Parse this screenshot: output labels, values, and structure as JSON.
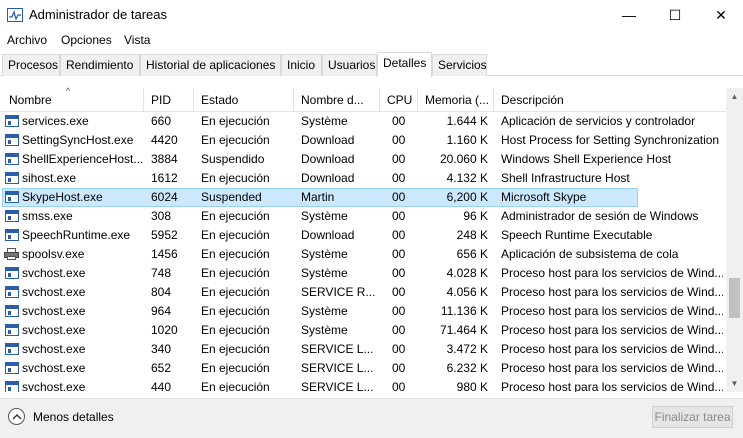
{
  "window": {
    "title": "Administrador de tareas",
    "min_glyph": "—",
    "max_glyph": "☐",
    "close_glyph": "✕"
  },
  "menu": [
    "Archivo",
    "Opciones",
    "Vista"
  ],
  "tabs": [
    "Procesos",
    "Rendimiento",
    "Historial de aplicaciones",
    "Inicio",
    "Usuarios",
    "Detalles",
    "Servicios"
  ],
  "active_tab": "Detalles",
  "columns": [
    "Nombre",
    "PID",
    "Estado",
    "Nombre d...",
    "CPU",
    "Memoria (...",
    "Descripción"
  ],
  "rows": [
    {
      "name": "services.exe",
      "pid": "660",
      "status": "En ejecución",
      "user": "Système",
      "cpu": "00",
      "mem": "1.644 K",
      "desc": "Aplicación de servicios y controlador",
      "icon": "process-icon"
    },
    {
      "name": "SettingSyncHost.exe",
      "pid": "4420",
      "status": "En ejecución",
      "user": "Download",
      "cpu": "00",
      "mem": "1.160 K",
      "desc": "Host Process for Setting Synchronization",
      "icon": "process-icon"
    },
    {
      "name": "ShellExperienceHost....",
      "pid": "3884",
      "status": "Suspendido",
      "user": "Download",
      "cpu": "00",
      "mem": "20.060 K",
      "desc": "Windows Shell Experience Host",
      "icon": "process-icon"
    },
    {
      "name": "sihost.exe",
      "pid": "1612",
      "status": "En ejecución",
      "user": "Download",
      "cpu": "00",
      "mem": "4.132 K",
      "desc": "Shell Infrastructure Host",
      "icon": "process-icon"
    },
    {
      "name": "SkypeHost.exe",
      "pid": "6024",
      "status": "Suspended",
      "user": "Martin",
      "cpu": "00",
      "mem": "6,200 K",
      "desc": "Microsoft Skype",
      "icon": "process-icon",
      "selected": true
    },
    {
      "name": "smss.exe",
      "pid": "308",
      "status": "En ejecución",
      "user": "Système",
      "cpu": "00",
      "mem": "96 K",
      "desc": "Administrador de sesión de Windows",
      "icon": "process-icon"
    },
    {
      "name": "SpeechRuntime.exe",
      "pid": "5952",
      "status": "En ejecución",
      "user": "Download",
      "cpu": "00",
      "mem": "248 K",
      "desc": "Speech Runtime Executable",
      "icon": "process-icon"
    },
    {
      "name": "spoolsv.exe",
      "pid": "1456",
      "status": "En ejecución",
      "user": "Système",
      "cpu": "00",
      "mem": "656 K",
      "desc": "Aplicación de subsistema de cola",
      "icon": "printer-icon"
    },
    {
      "name": "svchost.exe",
      "pid": "748",
      "status": "En ejecución",
      "user": "Système",
      "cpu": "00",
      "mem": "4.028 K",
      "desc": "Proceso host para los servicios de Wind...",
      "icon": "process-icon"
    },
    {
      "name": "svchost.exe",
      "pid": "804",
      "status": "En ejecución",
      "user": "SERVICE R...",
      "cpu": "00",
      "mem": "4.056 K",
      "desc": "Proceso host para los servicios de Wind...",
      "icon": "process-icon"
    },
    {
      "name": "svchost.exe",
      "pid": "964",
      "status": "En ejecución",
      "user": "Système",
      "cpu": "00",
      "mem": "11.136 K",
      "desc": "Proceso host para los servicios de Wind...",
      "icon": "process-icon"
    },
    {
      "name": "svchost.exe",
      "pid": "1020",
      "status": "En ejecución",
      "user": "Système",
      "cpu": "00",
      "mem": "71.464 K",
      "desc": "Proceso host para los servicios de Wind...",
      "icon": "process-icon"
    },
    {
      "name": "svchost.exe",
      "pid": "340",
      "status": "En ejecución",
      "user": "SERVICE L...",
      "cpu": "00",
      "mem": "3.472 K",
      "desc": "Proceso host para los servicios de Wind...",
      "icon": "process-icon"
    },
    {
      "name": "svchost.exe",
      "pid": "652",
      "status": "En ejecución",
      "user": "SERVICE L...",
      "cpu": "00",
      "mem": "6.232 K",
      "desc": "Proceso host para los servicios de Wind...",
      "icon": "process-icon"
    },
    {
      "name": "svchost.exe",
      "pid": "440",
      "status": "En ejecución",
      "user": "SERVICE L...",
      "cpu": "00",
      "mem": "980 K",
      "desc": "Proceso host para los servicios de Wind...",
      "icon": "process-icon"
    }
  ],
  "footer": {
    "less_details": "Menos detalles",
    "end_task": "Finalizar tarea"
  },
  "colors": {
    "selection_bg": "#cce8ff",
    "selection_border": "#99d1ff",
    "icon_blue": "#2a5ea8"
  }
}
